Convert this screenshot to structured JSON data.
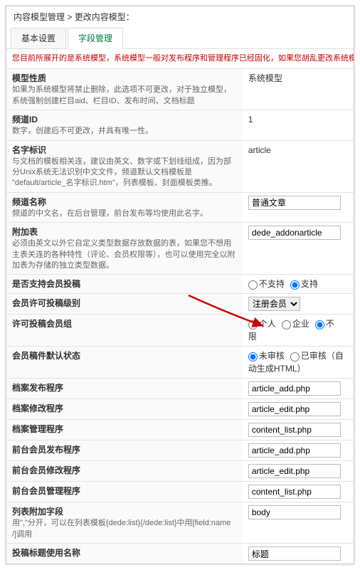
{
  "breadcrumb": {
    "a": "内容模型管理",
    "b": "更改内容模型：",
    "sep": " > "
  },
  "tabs": {
    "basic": "基本设置",
    "fields": "字段管理"
  },
  "warning": "您目前所展开的是系统模型，系统模型一般对发布程序和管理程序已经固化，如果您胡乱更改系统模型将会导致使用这件内容类型的频道可能",
  "rows": {
    "modelType": {
      "label": "模型性质",
      "desc": "如果为系统模型将禁止删除，此选项不可更改，对于独立模型，系统强制创建栏目aid、栏目ID、发布时间、文档标题",
      "value": "系统模型"
    },
    "channelId": {
      "label": "频道ID",
      "desc": "数字，创建后不可更改，并具有唯一性。",
      "value": "1"
    },
    "nameTag": {
      "label": "名字标识",
      "desc": "与文档的模板相关连，建议由英文、数字或下划线组成，因为部分Unix系统无法识别中文文件，频道默认文档模板是 \"default/article_名字标识.htm\"，列表模板、封面模板类推。",
      "value": "article"
    },
    "channelName": {
      "label": "频道名称",
      "desc": "频道的中文名，在后台管理，前台发布等均使用此名字。",
      "value": "普通文章"
    },
    "addonTable": {
      "label": "附加表",
      "desc": "必须由英文以外它自定义类型数据存放数据的表，如果您不想用主表关连的各种特性（评论、会员权限等），也可以使用完全以附加表为存储的独立类型数据。",
      "value": "dede_addonarticle"
    },
    "memberPost": {
      "label": "是否支持会员投稿",
      "opt1": "不支持",
      "opt2": "支持"
    },
    "memberLevel": {
      "label": "会员许可投稿级别",
      "value": "注册会员"
    },
    "memberType": {
      "label": "许可投稿会员组",
      "opt1": "个人",
      "opt2": "企业",
      "opt3": "不限"
    },
    "defaultStatus": {
      "label": "会员稿件默认状态",
      "opt1": "未审核",
      "opt2": "已审核（自动生成HTML）"
    },
    "pubTpl": {
      "label": "档案发布程序",
      "value": "article_add.php"
    },
    "editTpl": {
      "label": "档案修改程序",
      "value": "article_edit.php"
    },
    "manTpl": {
      "label": "档案管理程序",
      "value": "content_list.php"
    },
    "frontPub": {
      "label": "前台会员发布程序",
      "value": "article_add.php"
    },
    "frontEdit": {
      "label": "前台会员修改程序",
      "value": "article_edit.php"
    },
    "frontMan": {
      "label": "前台会员管理程序",
      "value": "content_list.php"
    },
    "listAdd": {
      "label": "列表附加字段",
      "desc": "用\",\"分开，可以在列表模板{dede:list}{/dede:list}中用[field:name /]调用",
      "value": "body"
    },
    "postAlias": {
      "label": "投稿标题使用名称",
      "value": "标题"
    }
  }
}
